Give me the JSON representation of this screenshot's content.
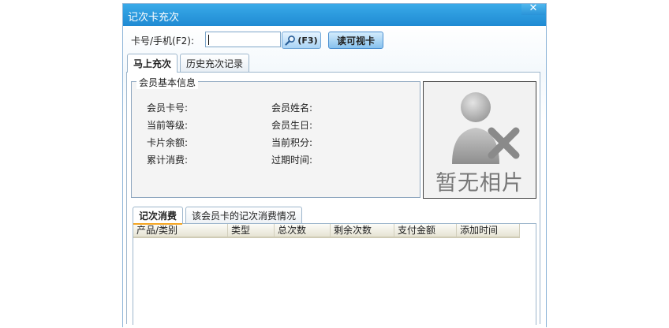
{
  "window": {
    "title": "记次卡充次",
    "close_glyph": "✕"
  },
  "search": {
    "label": "卡号/手机(F2):",
    "value": "",
    "f3_label": "(F3)",
    "read_card_label": "读可视卡"
  },
  "main_tabs": [
    {
      "label": "马上充次",
      "active": true
    },
    {
      "label": "历史充次记录",
      "active": false
    }
  ],
  "member_info": {
    "legend": "会员基本信息",
    "fields": {
      "card_no": "会员卡号:",
      "name": "会员姓名:",
      "level": "当前等级:",
      "birthday": "会员生日:",
      "balance": "卡片余额:",
      "points": "当前积分:",
      "total_spent": "累计消费:",
      "expiry": "过期时间:"
    }
  },
  "photo": {
    "placeholder_text": "暂无相片",
    "icon": "user-remove-icon"
  },
  "sub_tabs": [
    {
      "label": "记次消费",
      "active": true
    },
    {
      "label": "该会员卡的记次消费情况",
      "active": false
    }
  ],
  "table": {
    "columns": [
      "产品/类别",
      "类型",
      "总次数",
      "剩余次数",
      "支付金额",
      "添加时间"
    ],
    "rows": []
  },
  "colors": {
    "titlebar": "#2596de",
    "active_tab_underline": "#f5a623",
    "border": "#9db6cc"
  }
}
